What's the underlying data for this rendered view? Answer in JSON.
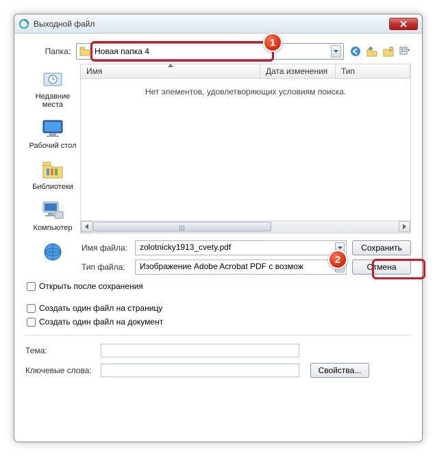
{
  "window": {
    "title": "Выходной файл"
  },
  "folder": {
    "label": "Папка:",
    "current": "Новая папка 4"
  },
  "columns": {
    "name": "Имя",
    "date": "Дата изменения",
    "type": "Тип"
  },
  "empty_msg": "Нет элементов, удовлетворяющих условиям поиска.",
  "places": {
    "recent": "Недавние\nместа",
    "desktop": "Рабочий стол",
    "libraries": "Библиотеки",
    "computer": "Компьютер",
    "network": "Сеть"
  },
  "filename": {
    "label": "Имя файла:",
    "value": "zolotnicky1913_cvety.pdf"
  },
  "filetype": {
    "label": "Тип файла:",
    "value": "Изображение Adobe Acrobat PDF с возмож"
  },
  "buttons": {
    "save": "Сохранить",
    "cancel": "Отмена",
    "properties": "Свойства..."
  },
  "checks": {
    "open_after": "Открыть после сохранения",
    "one_per_page": "Создать один файл на страницу",
    "one_per_doc": "Создать один файл на документ"
  },
  "meta": {
    "subject": "Тема:",
    "keywords": "Ключевые слова:"
  },
  "badges": {
    "b1": "1",
    "b2": "2"
  }
}
